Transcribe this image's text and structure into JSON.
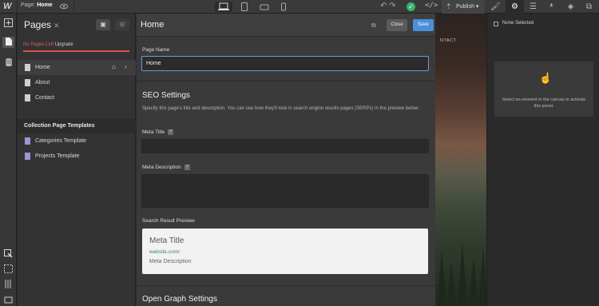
{
  "topbar": {
    "logo": "W",
    "page_prefix": "Page:",
    "page_name": "Home",
    "publish_label": "Publish"
  },
  "pages_panel": {
    "title": "Pages",
    "warning": "No Pages Left",
    "upgrade": "Upgrade",
    "pages": [
      {
        "label": "Home"
      },
      {
        "label": "About"
      },
      {
        "label": "Contact"
      }
    ],
    "collection_section": "Collection Page Templates",
    "templates": [
      {
        "label": "Categories Template"
      },
      {
        "label": "Projects Template"
      }
    ]
  },
  "settings": {
    "title": "Home",
    "close_label": "Close",
    "save_label": "Save",
    "page_name_label": "Page Name",
    "page_name_value": "Home",
    "seo_title": "SEO Settings",
    "seo_desc": "Specify this page's title and description. You can see how they'll look in search engine results pages (SERPs) in the preview below.",
    "meta_title_label": "Meta Title",
    "meta_description_label": "Meta Description",
    "preview_label": "Search Result Preview",
    "preview": {
      "title": "Meta Title",
      "url": "website.com/",
      "description": "Meta Description"
    },
    "og_title": "Open Graph Settings"
  },
  "canvas": {
    "fragment_text": "NTACT"
  },
  "right_panel": {
    "none_selected": "None Selected",
    "message": "Select an element in the canvas to activate this panel."
  },
  "colors": {
    "accent_blue": "#4a90d9",
    "warning_red": "#d9534f",
    "success_green": "#3cb371",
    "template_purple": "#a391d6"
  }
}
